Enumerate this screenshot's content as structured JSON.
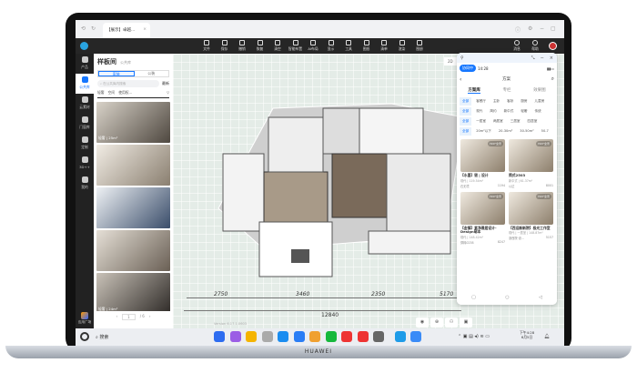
{
  "device": {
    "brand": "HUAWEI"
  },
  "browser": {
    "tab_title": "【展示】卓越...",
    "tab_close": "×"
  },
  "toolbar": {
    "items": [
      "文件",
      "保存",
      "撤销",
      "恢复",
      "清空",
      "智能布置",
      "AI布局",
      "显示",
      "工具",
      "图纸",
      "清单",
      "渲染",
      "图册"
    ],
    "right": [
      "消息",
      "帮助"
    ]
  },
  "rail": {
    "items": [
      "产品",
      "公共库",
      "云素材",
      "门窗库",
      "定制",
      "3D++",
      "我的"
    ],
    "bottom": "应用广场"
  },
  "panel": {
    "title": "样板间",
    "tag": "公共库",
    "tabs": [
      "家装",
      "公装"
    ],
    "search_placeholder": "在公共库内搜索",
    "sort": "最新",
    "filters": [
      "轻奢",
      "空间",
      "使用权..."
    ],
    "thumbs": [
      "轻奢 | 25m²",
      "",
      "",
      "",
      "轻奢 | 24m²",
      ""
    ],
    "page": "1",
    "total": "/ 6"
  },
  "canvas": {
    "view_2d": "2D",
    "dims": [
      "2750",
      "3460",
      "2350",
      "5170"
    ],
    "total_dim": "12840",
    "version": "Version 6.17.1.0603"
  },
  "phone": {
    "status_pill": "协同中",
    "time": "14:28",
    "title": "方案",
    "tabs": [
      "方案库",
      "专栏",
      "效果图"
    ],
    "chip_rows": [
      [
        "全部",
        "客餐厅",
        "主卧",
        "客卧",
        "厨房",
        "儿童房"
      ],
      [
        "全部",
        "现代",
        "简约",
        "新中式",
        "轻奢",
        "传统"
      ],
      [
        "全部",
        "一居室",
        "两居室",
        "三居室",
        "四居室"
      ],
      [
        "全部",
        "20m²以下",
        "20-30m²",
        "30-50m²",
        "50-7"
      ]
    ],
    "badge": "720°全景",
    "cards": [
      {
        "title": "【水墨】银 | 设计",
        "sub": "现代 | 119.54m²",
        "author": "石无境",
        "views": "1194"
      },
      {
        "title": "简式2503",
        "sub": "新中式 | 61.37m²",
        "author": "以达",
        "views": "8001"
      },
      {
        "title": "【金镇】素净雅居设计-Design萌本",
        "sub": "现代 | 148.42m²",
        "author": "穿棉0238",
        "views": "8247"
      },
      {
        "title": "【西运新新院】极光工作室",
        "sub": "现代 | 一居室 | 148.87m²",
        "author": "浙西院·设...",
        "views": "5157"
      }
    ]
  },
  "taskbar": {
    "search": "搜索",
    "time": "下午4:28",
    "date": "6月5日"
  },
  "colors": {
    "accent": "#1677ff",
    "toolbar": "#262626",
    "canvas": "#e4ece7"
  }
}
